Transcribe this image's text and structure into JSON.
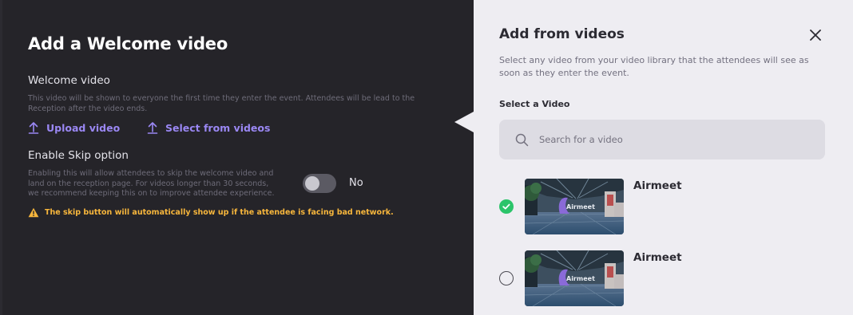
{
  "left": {
    "title": "Add a Welcome video",
    "welcome_video": {
      "label": "Welcome video",
      "description_line1": "This video will be shown to everyone the first time they enter the event. Attendees will be lead to the",
      "description_line2": "Reception after the video ends."
    },
    "links": {
      "upload_label": "Upload video",
      "select_label": "Select from videos",
      "icon": "upload-arrow-icon"
    },
    "skip": {
      "label": "Enable Skip option",
      "description_line1": "Enabling this will allow attendees to skip the welcome video and",
      "description_line2": "land on the reception page. For videos longer than 30 seconds,",
      "description_line3": "we recommend keeping this on to improve attendee experience.",
      "toggle_state": "off",
      "toggle_label": "No"
    },
    "warning": {
      "text": "The skip button will automatically show up if the attendee is facing bad network.",
      "icon": "warning-icon",
      "color": "#f7b63c"
    }
  },
  "right": {
    "title": "Add from videos",
    "close_icon": "close-icon",
    "description": "Select any video from your video library that the attendees will see as soon as they enter the event.",
    "select_label": "Select a Video",
    "search": {
      "placeholder": "Search for a video",
      "value": "",
      "icon": "search-icon"
    },
    "videos": [
      {
        "title": "Airmeet",
        "thumbnail_text": "Airmeet",
        "selected": true
      },
      {
        "title": "Airmeet",
        "thumbnail_text": "Airmeet",
        "selected": false
      }
    ]
  },
  "colors": {
    "accent": "#9a87f3",
    "selected": "#2bc46a",
    "dark_panel": "#252429",
    "light_panel": "#eeedf2"
  }
}
